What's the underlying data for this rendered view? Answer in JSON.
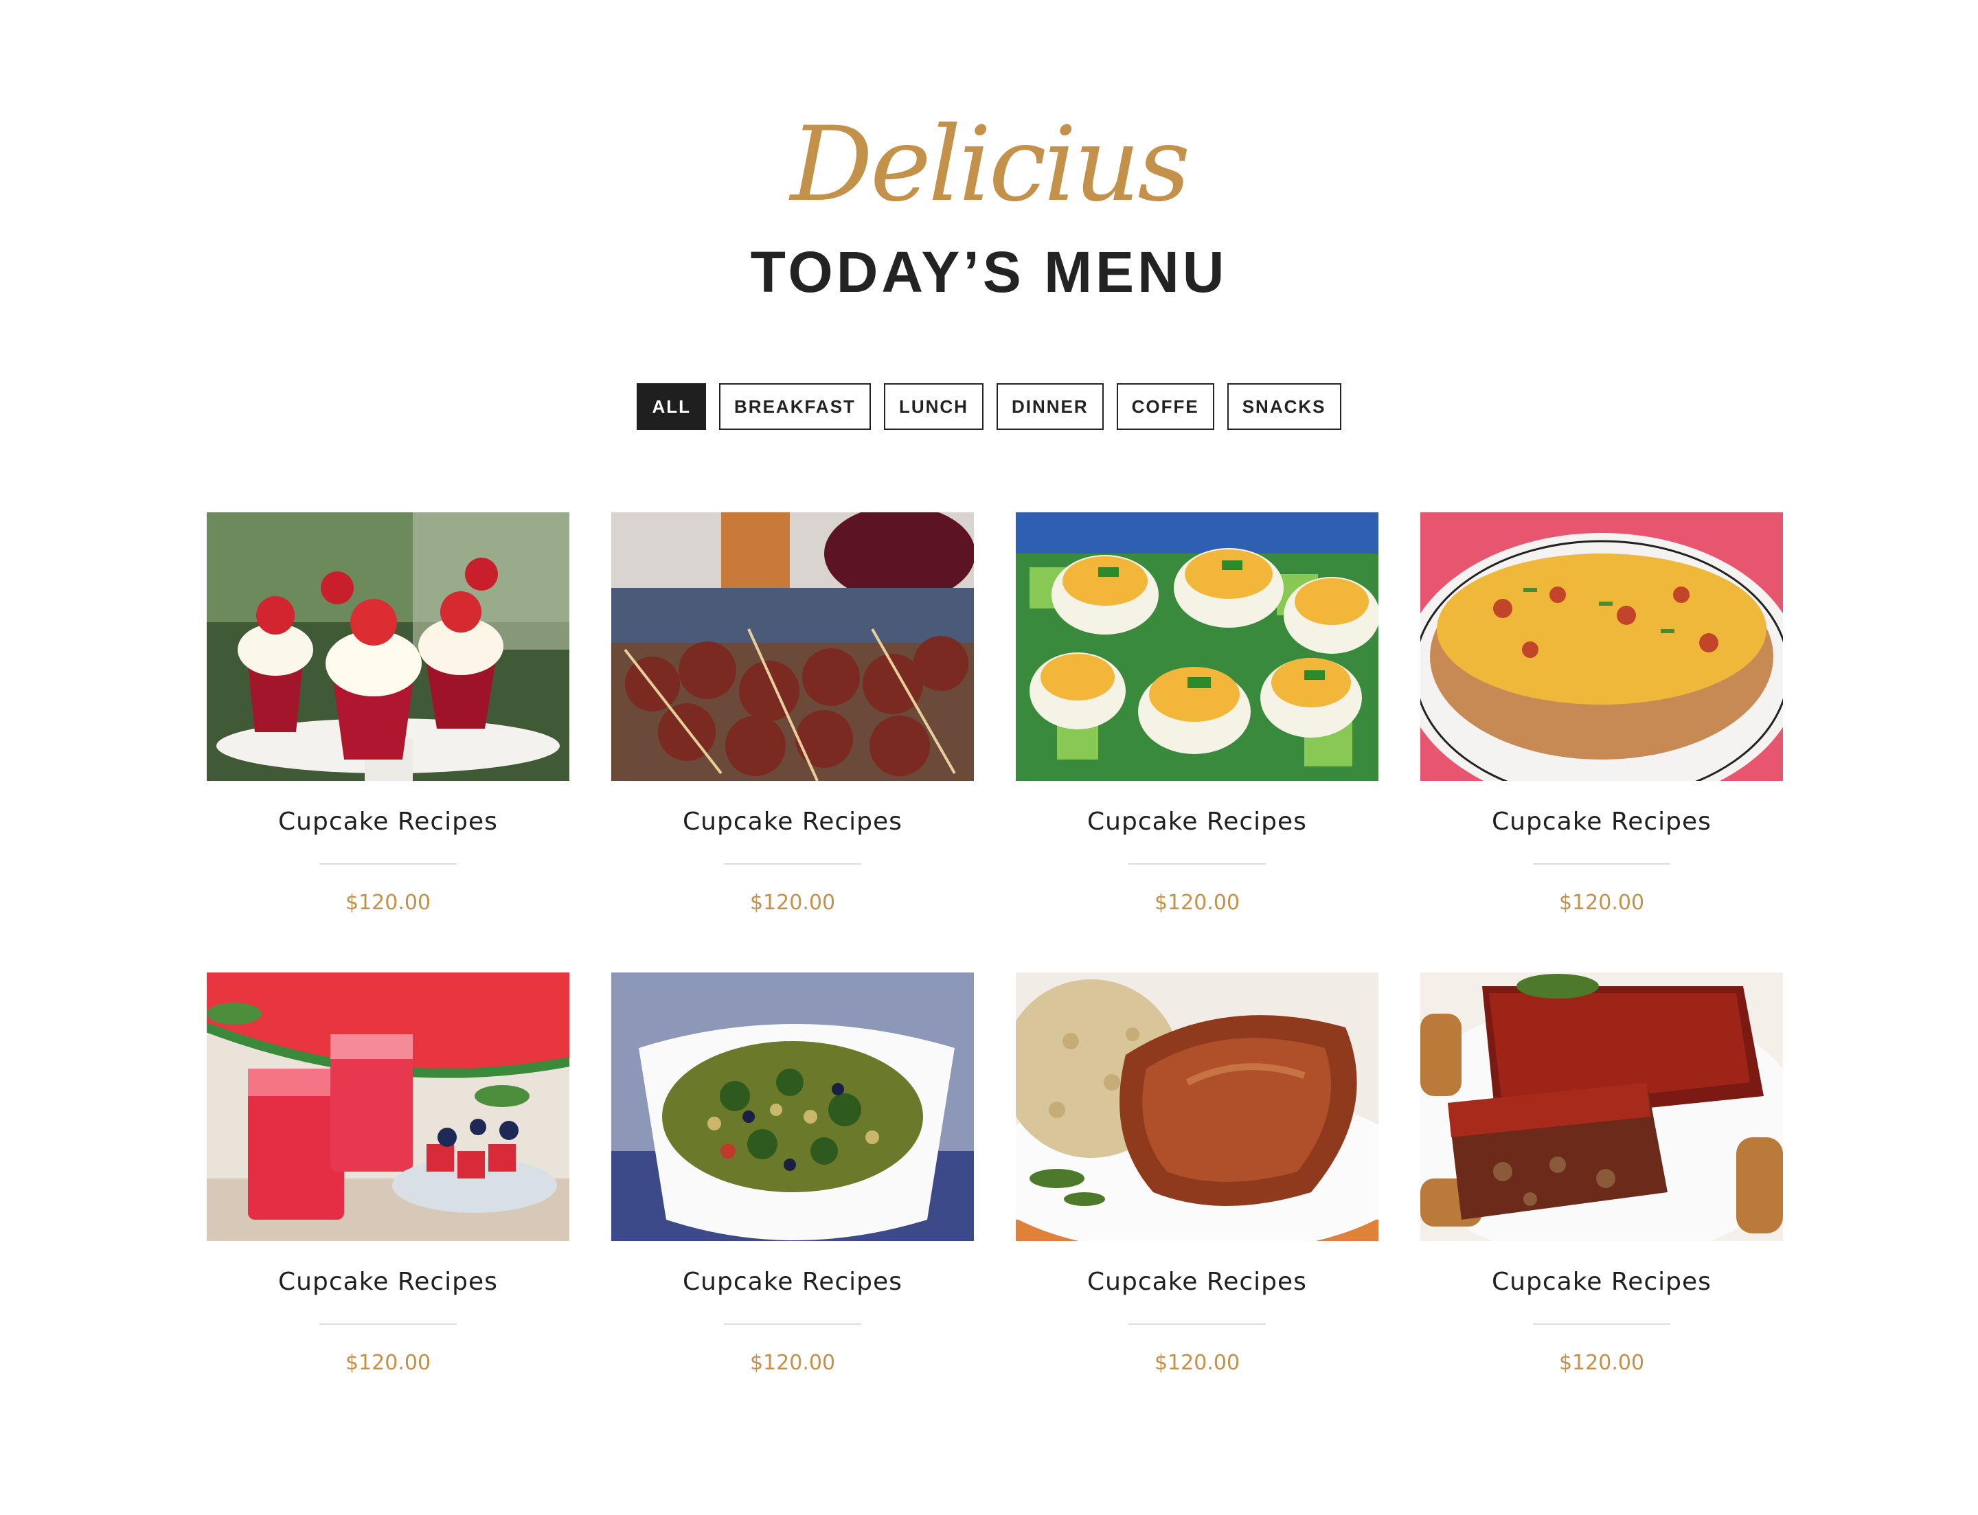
{
  "header": {
    "script_title": "Delicius",
    "title": "TODAY’S MENU"
  },
  "filters": [
    {
      "label": "ALL",
      "active": true
    },
    {
      "label": "BREAKFAST",
      "active": false
    },
    {
      "label": "LUNCH",
      "active": false
    },
    {
      "label": "DINNER",
      "active": false
    },
    {
      "label": "COFFE",
      "active": false
    },
    {
      "label": "SNACKS",
      "active": false
    }
  ],
  "menu_items": [
    {
      "title": "Cupcake Recipes",
      "price": "$120.00",
      "image": "strawberry-cupcakes"
    },
    {
      "title": "Cupcake Recipes",
      "price": "$120.00",
      "image": "bacon-wrapped-skewers"
    },
    {
      "title": "Cupcake Recipes",
      "price": "$120.00",
      "image": "deviled-eggs"
    },
    {
      "title": "Cupcake Recipes",
      "price": "$120.00",
      "image": "loaded-baked-potato"
    },
    {
      "title": "Cupcake Recipes",
      "price": "$120.00",
      "image": "watermelon-juice"
    },
    {
      "title": "Cupcake Recipes",
      "price": "$120.00",
      "image": "quinoa-salad"
    },
    {
      "title": "Cupcake Recipes",
      "price": "$120.00",
      "image": "glazed-pork-chop"
    },
    {
      "title": "Cupcake Recipes",
      "price": "$120.00",
      "image": "meatloaf"
    }
  ],
  "colors": {
    "accent": "#c4914a",
    "text": "#232323",
    "active_filter_bg": "#1f1f1f"
  }
}
